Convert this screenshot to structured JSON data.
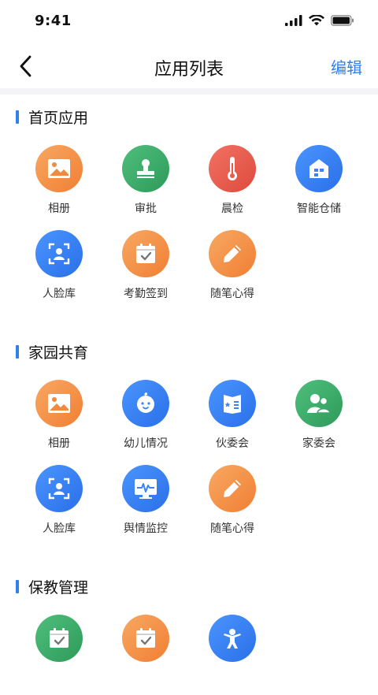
{
  "status": {
    "time": "9:41"
  },
  "nav": {
    "title": "应用列表",
    "edit_label": "编辑"
  },
  "sections": [
    {
      "title": "首页应用",
      "apps": [
        {
          "label": "相册",
          "icon": "photo-icon",
          "color": "orange"
        },
        {
          "label": "审批",
          "icon": "stamp-icon",
          "color": "green"
        },
        {
          "label": "晨检",
          "icon": "thermometer-icon",
          "color": "red"
        },
        {
          "label": "智能仓储",
          "icon": "warehouse-icon",
          "color": "blue"
        },
        {
          "label": "人脸库",
          "icon": "face-scan-icon",
          "color": "blue"
        },
        {
          "label": "考勤签到",
          "icon": "calendar-check-icon",
          "color": "orange"
        },
        {
          "label": "随笔心得",
          "icon": "pencil-icon",
          "color": "orange"
        }
      ]
    },
    {
      "title": "家园共育",
      "apps": [
        {
          "label": "相册",
          "icon": "photo-icon",
          "color": "orange"
        },
        {
          "label": "幼儿情况",
          "icon": "baby-face-icon",
          "color": "blue"
        },
        {
          "label": "伙委会",
          "icon": "menu-book-icon",
          "color": "blue"
        },
        {
          "label": "家委会",
          "icon": "family-icon",
          "color": "green"
        },
        {
          "label": "人脸库",
          "icon": "face-scan-icon",
          "color": "blue"
        },
        {
          "label": "舆情监控",
          "icon": "monitor-pulse-icon",
          "color": "blue"
        },
        {
          "label": "随笔心得",
          "icon": "pencil-icon",
          "color": "orange"
        }
      ]
    },
    {
      "title": "保教管理",
      "apps": [
        {
          "label": "",
          "icon": "calendar-check-icon",
          "color": "green"
        },
        {
          "label": "",
          "icon": "calendar-check-icon",
          "color": "orange"
        },
        {
          "label": "",
          "icon": "child-activity-icon",
          "color": "blue"
        }
      ]
    }
  ],
  "colors": {
    "accent": "#2f80ed",
    "orange": "#f39148",
    "green": "#3aa967",
    "red": "#e85a4b",
    "blue": "#3a84f5"
  }
}
